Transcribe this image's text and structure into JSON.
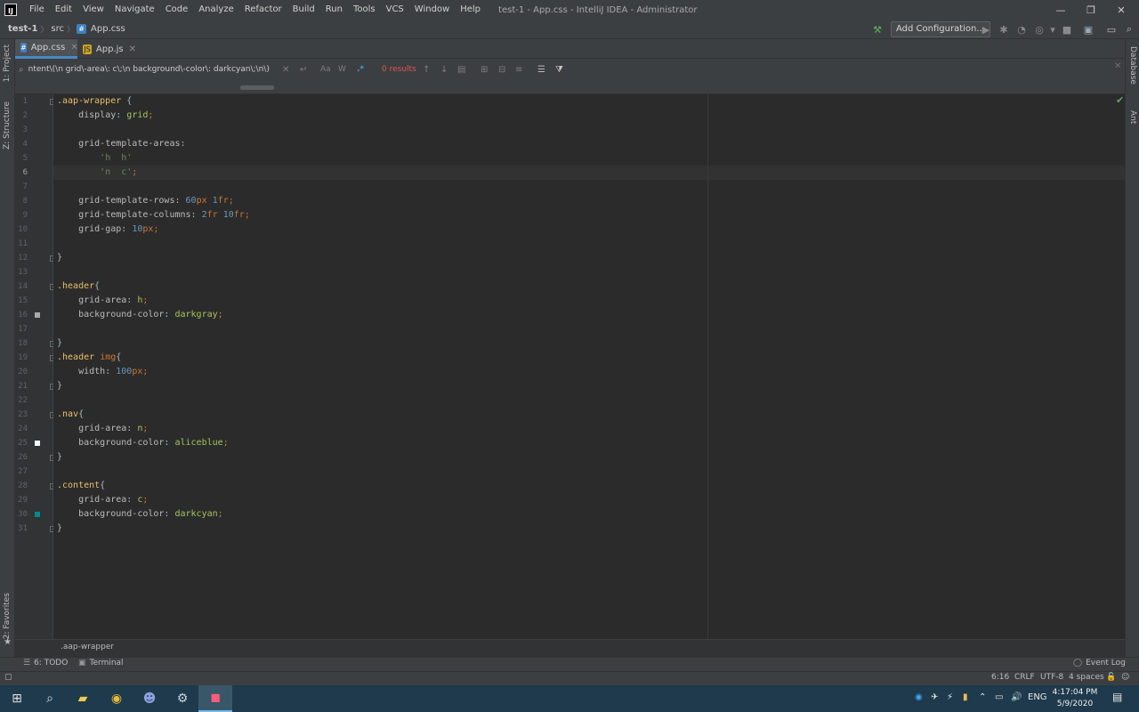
{
  "window": {
    "logo": "IJ",
    "title": "test-1 - App.css - IntelliJ IDEA - Administrator",
    "menu": [
      "File",
      "Edit",
      "View",
      "Navigate",
      "Code",
      "Analyze",
      "Refactor",
      "Build",
      "Run",
      "Tools",
      "VCS",
      "Window",
      "Help"
    ],
    "controls": {
      "minimize": "—",
      "maximize": "❐",
      "close": "✕"
    }
  },
  "navbar": {
    "project": "test-1",
    "folder": "src",
    "file": "App.css",
    "separator": "〉",
    "add_configuration": "Add Configuration..."
  },
  "left_strip": {
    "project": "1: Project",
    "structure": "Z: Structure",
    "favorites": "2: Favorites"
  },
  "right_strip": {
    "database": "Database",
    "ant": "Ant"
  },
  "tabs": [
    {
      "label": "App.css",
      "close": "✕",
      "active": true
    },
    {
      "label": "App.js",
      "close": "✕",
      "active": false
    }
  ],
  "search": {
    "query": "ntent\\(\\n    grid\\-area\\: c\\;\\n    background\\-color\\: darkcyan\\;\\n\\)",
    "match_case": "Aa",
    "words": "W",
    "regex": ".*",
    "results": "0 results",
    "close": "✕"
  },
  "editor": {
    "lines": [
      "1",
      "2",
      "3",
      "4",
      "5",
      "6",
      "7",
      "8",
      "9",
      "10",
      "11",
      "12",
      "13",
      "14",
      "15",
      "16",
      "17",
      "18",
      "19",
      "20",
      "21",
      "22",
      "23",
      "24",
      "25",
      "26",
      "27",
      "28",
      "29",
      "30",
      "31"
    ],
    "code": {
      "l1_sel": ".aap-wrapper",
      "l1_brace": " {",
      "l2_prop": "display",
      "l2_val": "grid",
      "l4_prop": "grid-template-areas",
      "l5_str": "'h  h'",
      "l6_str": "'n  c'",
      "l8_prop": "grid-template-rows",
      "l8_n1": "60",
      "l8_u1": "px",
      "l8_n2": "1",
      "l8_u2": "fr",
      "l9_prop": "grid-template-columns",
      "l9_n1": "2",
      "l9_u1": "fr",
      "l9_n2": "10",
      "l9_u2": "fr",
      "l10_prop": "grid-gap",
      "l10_n": "10",
      "l10_u": "px",
      "l12_brace": "}",
      "l14_sel": ".header",
      "l14_brace": "{",
      "l15_prop": "grid-area",
      "l15_val": "h",
      "l16_prop": "background-color",
      "l16_val": "darkgray",
      "l18_brace": "}",
      "l19_sel": ".header",
      "l19_tag": "img",
      "l19_brace": "{",
      "l20_prop": "width",
      "l20_n": "100",
      "l20_u": "px",
      "l21_brace": "}",
      "l23_sel": ".nav",
      "l23_brace": "{",
      "l24_prop": "grid-area",
      "l24_val": "n",
      "l25_prop": "background-color",
      "l25_val": "aliceblue",
      "l26_brace": "}",
      "l28_sel": ".content",
      "l28_brace": "{",
      "l29_prop": "grid-area",
      "l29_val": "c",
      "l30_prop": "background-color",
      "l30_val": "darkcyan",
      "l31_brace": "}"
    },
    "swatches": {
      "darkgray": "#a9a9a9",
      "aliceblue": "#f0f8ff",
      "darkcyan": "#008b8b"
    }
  },
  "breadcrumb": ".aap-wrapper",
  "tool_windows": {
    "todo": "6: TODO",
    "terminal": "Terminal",
    "event_log": "Event Log"
  },
  "status": {
    "position": "6:16",
    "line_sep": "CRLF",
    "encoding": "UTF-8",
    "indent": "4 spaces"
  },
  "taskbar": {
    "lang": "ENG",
    "time": "4:17:04 PM",
    "date": "5/9/2020"
  }
}
